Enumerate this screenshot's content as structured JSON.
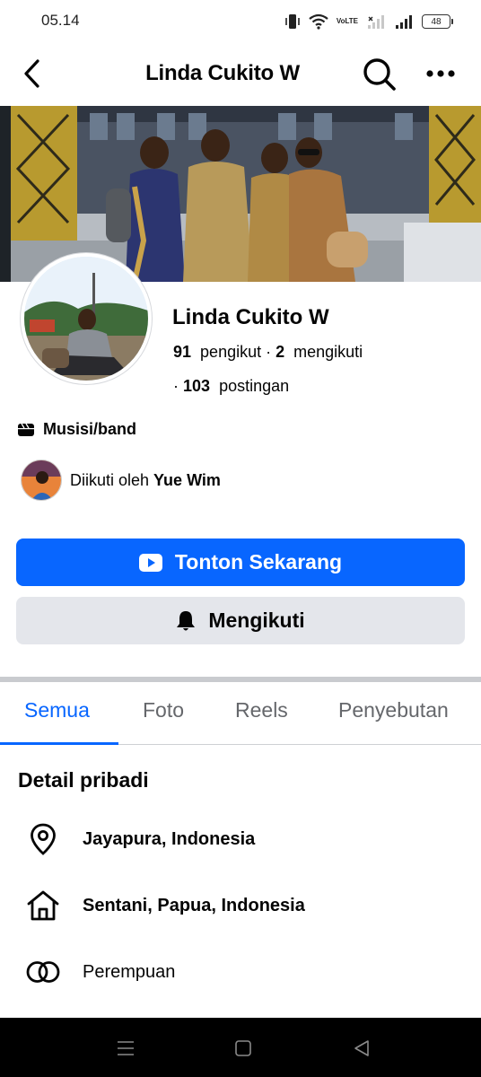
{
  "status_bar": {
    "time": "05.14",
    "volte_top": "Vo",
    "volte_bottom": "LTE",
    "battery": "48",
    "icons": [
      "vibrate-icon",
      "wifi-icon",
      "volte-icon",
      "signal-empty-icon",
      "signal-icon",
      "battery-icon"
    ]
  },
  "header": {
    "title": "Linda Cukito W",
    "icons": [
      "back-arrow-icon",
      "search-icon",
      "more-dots-icon"
    ]
  },
  "profile": {
    "name": "Linda Cukito W",
    "followers_count": "91",
    "followers_label": "pengikut · ",
    "following_count": "2",
    "following_label": "mengikuti",
    "posts_prefix": "· ",
    "posts_count": "103",
    "posts_label": "postingan",
    "category": "Musisi/band",
    "followed_by_prefix": "Diikuti oleh ",
    "followed_by_name": "Yue Wim"
  },
  "actions": {
    "primary_label": "Tonton Sekarang",
    "secondary_label": "Mengikuti"
  },
  "tabs": [
    {
      "label": "Semua",
      "active": true
    },
    {
      "label": "Foto",
      "active": false
    },
    {
      "label": "Reels",
      "active": false
    },
    {
      "label": "Penyebutan",
      "active": false
    }
  ],
  "details": {
    "title": "Detail pribadi",
    "items": [
      {
        "icon": "location-pin-icon",
        "text": "Jayapura, Indonesia",
        "bold": true
      },
      {
        "icon": "home-icon",
        "text": "Sentani, Papua, Indonesia",
        "bold": true
      },
      {
        "icon": "gender-rings-icon",
        "text": "Perempuan",
        "bold": false
      }
    ]
  },
  "colors": {
    "accent": "#0866ff",
    "secondary_button": "#e4e6eb",
    "muted_text": "#65676b"
  }
}
